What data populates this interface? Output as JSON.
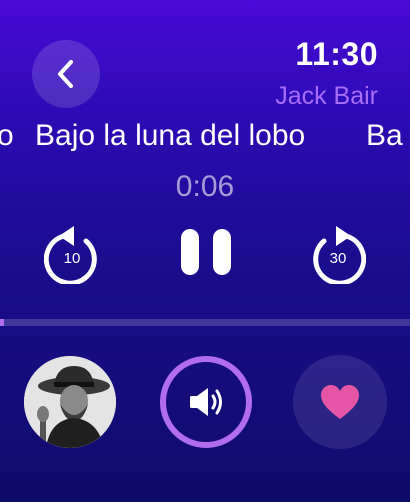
{
  "status": {
    "time": "11:30"
  },
  "track": {
    "artist": "Jack Bair",
    "title": "Bajo la luna del lobo",
    "title_wrap": "Ba",
    "title_tail": "o",
    "elapsed": "0:06",
    "progress": 0.01
  },
  "controls": {
    "back_label": "10",
    "forward_label": "30"
  },
  "icons": {
    "back": "chevron-left-icon",
    "rewind": "rewind-10-icon",
    "pause": "pause-icon",
    "forward": "forward-30-icon",
    "volume": "speaker-icon",
    "like": "heart-icon"
  },
  "colors": {
    "accent": "#a86df7",
    "ring": "#b16cf0",
    "heart": "#e455a5"
  }
}
